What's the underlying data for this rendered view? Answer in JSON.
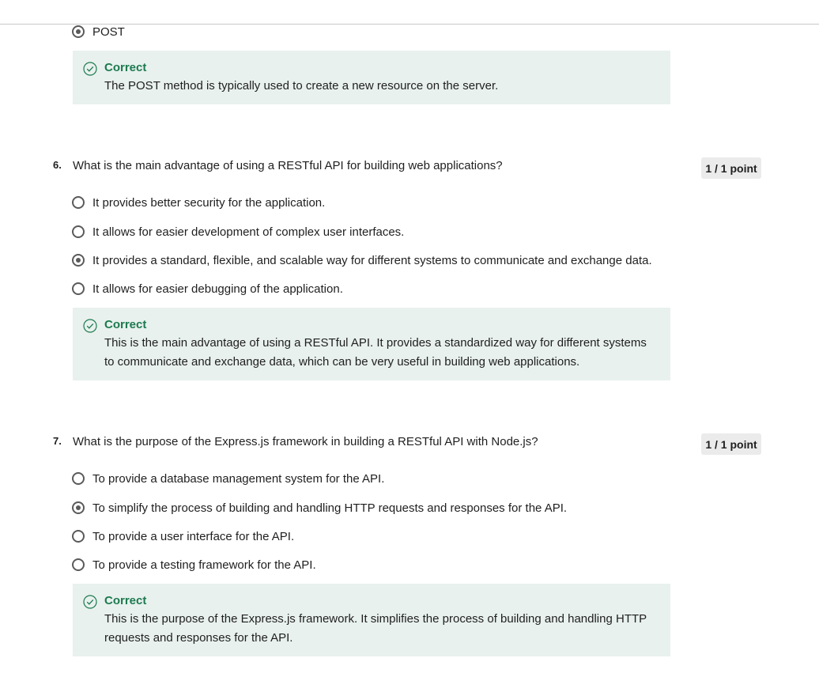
{
  "q5": {
    "selected_option": "POST",
    "feedback": {
      "title": "Correct",
      "text": "The POST method is typically used to create a new resource on the server."
    }
  },
  "q6": {
    "number": "6.",
    "question": "What is the main advantage of using a RESTful API for building web applications?",
    "points": "1 / 1 point",
    "options": [
      {
        "label": "It provides better security for the application.",
        "selected": false
      },
      {
        "label": "It allows for easier development of complex user interfaces.",
        "selected": false
      },
      {
        "label": "It provides a standard, flexible, and scalable way for different systems to communicate and exchange data.",
        "selected": true
      },
      {
        "label": "It allows for easier debugging of the application.",
        "selected": false
      }
    ],
    "feedback": {
      "title": "Correct",
      "text": "This is the main advantage of using a RESTful API. It provides a standardized way for different systems to communicate and exchange data, which can be very useful in building web applications."
    }
  },
  "q7": {
    "number": "7.",
    "question": "What is the purpose of the Express.js framework in building a RESTful API with Node.js?",
    "points": "1 / 1 point",
    "options": [
      {
        "label": "To provide a database management system for the API.",
        "selected": false
      },
      {
        "label": "To simplify the process of building and handling HTTP requests and responses for the API.",
        "selected": true
      },
      {
        "label": "To provide a user interface for the API.",
        "selected": false
      },
      {
        "label": "To provide a testing framework for the API.",
        "selected": false
      }
    ],
    "feedback": {
      "title": "Correct",
      "text": "This is the purpose of the Express.js framework. It simplifies the process of building and handling HTTP requests and responses for the API."
    }
  },
  "colors": {
    "correct_green": "#1d7a4f",
    "feedback_bg": "#e8f1ee",
    "points_bg": "#ebebeb"
  }
}
